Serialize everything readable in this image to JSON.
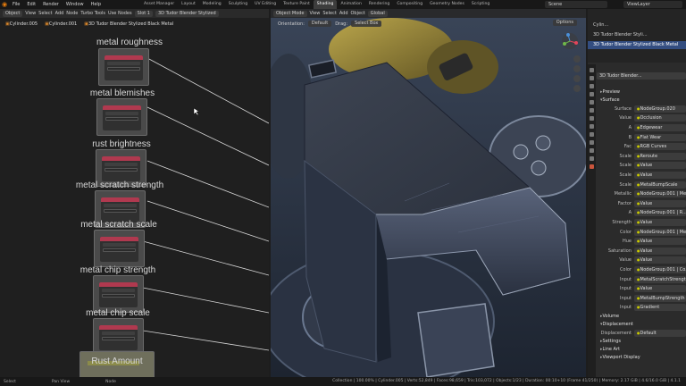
{
  "topbar": {
    "menu": [
      "File",
      "Edit",
      "Render",
      "Window",
      "Help"
    ],
    "workspaces": [
      "Asset Manager",
      "Layout",
      "Modeling",
      "Sculpting",
      "UV Editing",
      "Texture Paint",
      "Shading",
      "Animation",
      "Rendering",
      "Compositing",
      "Geometry Nodes",
      "Scripting"
    ],
    "active_workspace": "Shading",
    "scene": "Scene",
    "view_layer": "ViewLayer"
  },
  "node_editor": {
    "header": {
      "mode": "Object",
      "menus": [
        "View",
        "Select",
        "Add",
        "Node",
        "Turbo Tools"
      ],
      "use_nodes": "Use Nodes",
      "slot": "Slot 1",
      "material": "3D Tudor Blender Stylized"
    },
    "breadcrumbs": [
      "Cylinder.005",
      "Cylinder.001",
      "3D Tudor Blender Stylized Black Metal"
    ],
    "node_titles": [
      "metal roughness",
      "metal blemishes",
      "rust brightness",
      "metal scratch strength",
      "metal scratch scale",
      "metal chip strength",
      "metal chip scale",
      "Rust Amount"
    ]
  },
  "viewport": {
    "header": {
      "mode": "Object Mode",
      "menus": [
        "View",
        "Select",
        "Add",
        "Object"
      ],
      "orientation": "Global"
    },
    "header2": {
      "orientation_label": "Orientation:",
      "orientation_value": "Default",
      "drag_label": "Drag:",
      "drag_value": "Select Box"
    },
    "options": "Options"
  },
  "properties": {
    "outliner": [
      "Cylin...",
      "3D Tudor Blender Styli...",
      "3D Tudor Blender Stylized Black Metal"
    ],
    "material_slot": "3D Tudor Blender...",
    "sections": {
      "preview": "Preview",
      "surface": "Surface",
      "volume": "Volume",
      "displacement": "Displacement",
      "settings": "Settings",
      "lineart": "Line Art",
      "viewport_display": "Viewport Display"
    },
    "surface_rows": [
      {
        "label": "Surface",
        "value": "NodeGroup.020"
      },
      {
        "label": "Value",
        "value": "Occlusion"
      },
      {
        "label": "A",
        "value": "Edgewear"
      },
      {
        "label": "B",
        "value": "Flat Wear"
      },
      {
        "label": "Fac",
        "value": "RGB Curves"
      },
      {
        "label": "Scale",
        "value": "Reroute"
      },
      {
        "label": "Scale",
        "value": "Value"
      },
      {
        "label": "Scale",
        "value": "Value"
      },
      {
        "label": "Scale",
        "value": "MetalBumpScale"
      },
      {
        "label": "Metallic",
        "value": "NodeGroup.001 | Me..."
      },
      {
        "label": "Factor",
        "value": "Value"
      },
      {
        "label": "A",
        "value": "NodeGroup.001 | R..."
      },
      {
        "label": "Strength",
        "value": "Value"
      },
      {
        "label": "Color",
        "value": "NodeGroup.001 | Me..."
      },
      {
        "label": "Hue",
        "value": "Value"
      },
      {
        "label": "Saturation",
        "value": "Value"
      },
      {
        "label": "Value",
        "value": "Value"
      },
      {
        "label": "Color",
        "value": "NodeGroup.001 | Co..."
      },
      {
        "label": "Input",
        "value": "MetalScratchStrength"
      },
      {
        "label": "Input",
        "value": "Value"
      },
      {
        "label": "Input",
        "value": "MetalBumpStrength"
      },
      {
        "label": "Input",
        "value": "Gradient"
      }
    ],
    "displacement_row": {
      "label": "Displacement",
      "value": "Default"
    }
  },
  "status": {
    "left": [
      "Select",
      "Pan View",
      "Node"
    ],
    "right": "Collection | 100.00% | Cylinder.005 | Verts:52,849 | Faces:98,659 | Tris:103,072 | Objects:1/23 | Duration: 00:10+10 (Frame 41/250) | Memory: 2.17 GiB | 4.6/16.0 GiB | 4.1.1"
  },
  "colors": {
    "accent": "#e87d0d",
    "node_header_red": "#b0394f",
    "selection_blue": "#334d80"
  }
}
